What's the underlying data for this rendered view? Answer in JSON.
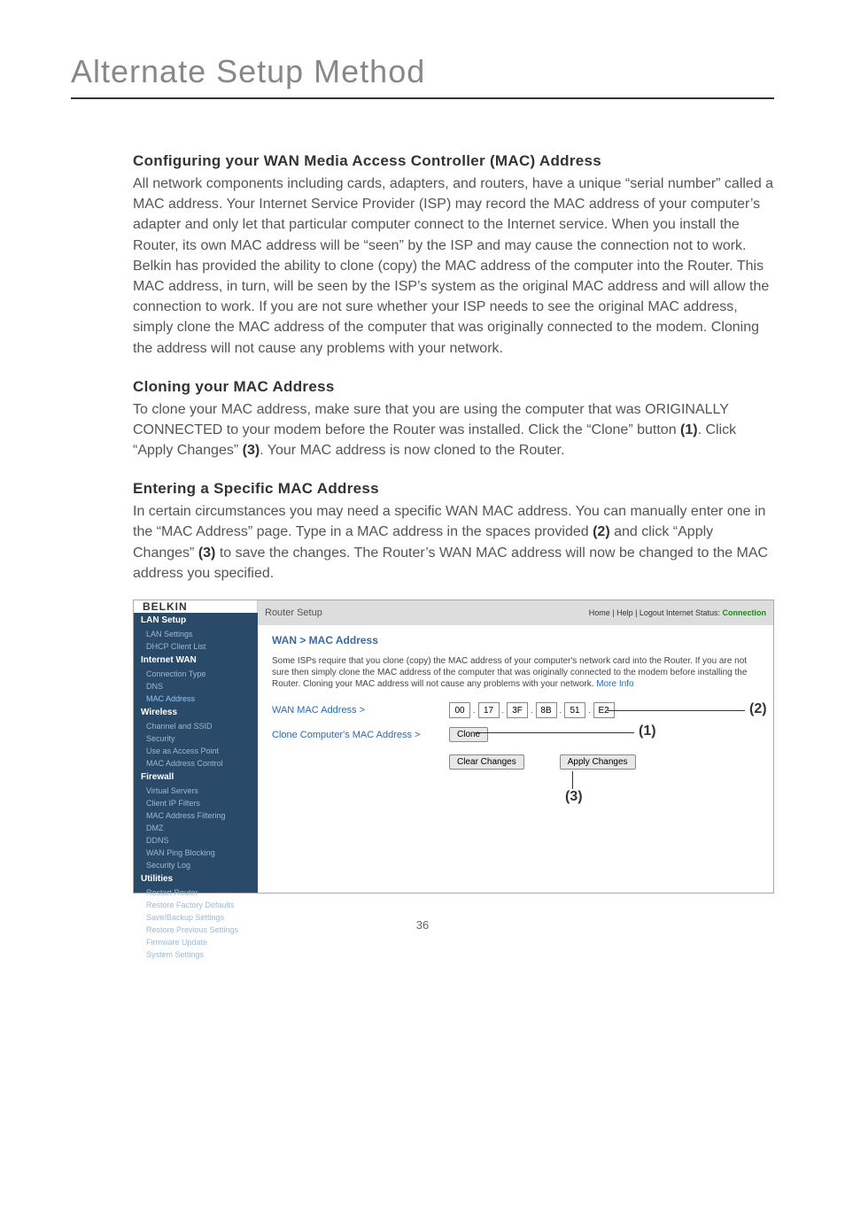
{
  "page_title": "Alternate Setup Method",
  "page_number": "36",
  "sections": {
    "configuring": {
      "heading": "Configuring your WAN Media Access Controller (MAC) Address",
      "body": "All network components including cards, adapters, and routers, have a unique “serial number” called a MAC address. Your Internet Service Provider (ISP) may record the MAC address of your computer’s adapter and only let that particular computer connect to the Internet service. When you install the Router, its own MAC address will be “seen” by the ISP and may cause the connection not to work. Belkin has provided the ability to clone (copy) the MAC address of the computer into the Router. This MAC address, in turn, will be seen by the ISP’s system as the original MAC address and will allow the connection to work. If you are not sure whether your ISP needs to see the original MAC address, simply clone the MAC address of the computer that was originally connected to the modem. Cloning the address will not cause any problems with your network."
    },
    "cloning": {
      "heading": "Cloning your MAC Address",
      "body_pre": "To clone your MAC address, make sure that you are using the computer that was ORIGINALLY CONNECTED to your modem before the Router was installed. Click the “Clone” button ",
      "b1": "(1)",
      "body_mid": ". Click “Apply Changes” ",
      "b3": "(3)",
      "body_post": ". Your MAC address is now cloned to the Router."
    },
    "entering": {
      "heading": "Entering a Specific MAC Address",
      "body_pre": "In certain circumstances you may need a specific WAN MAC address. You can manually enter one in the “MAC Address” page. Type in a MAC address in the spaces provided ",
      "b2": "(2)",
      "body_mid": " and click “Apply Changes” ",
      "b3": "(3)",
      "body_post": " to save the changes. The Router’s WAN MAC address will now be changed to the MAC address you specified."
    }
  },
  "router": {
    "logo": "BELKIN",
    "topbar_title": "Router Setup",
    "status_links": "Home | Help | Logout   Internet Status:",
    "status_value": "Connection",
    "sidebar": {
      "g1": "LAN Setup",
      "i1": "LAN Settings",
      "i2": "DHCP Client List",
      "g2": "Internet WAN",
      "i3": "Connection Type",
      "i4": "DNS",
      "i5": "MAC Address",
      "g3": "Wireless",
      "i6": "Channel and SSID",
      "i7": "Security",
      "i8": "Use as Access Point",
      "i9": "MAC Address Control",
      "g4": "Firewall",
      "i10": "Virtual Servers",
      "i11": "Client IP Filters",
      "i12": "MAC Address Filtering",
      "i13": "DMZ",
      "i14": "DDNS",
      "i15": "WAN Ping Blocking",
      "i16": "Security Log",
      "g5": "Utilities",
      "i17": "Restart Router",
      "i18": "Restore Factory Defaults",
      "i19": "Save/Backup Settings",
      "i20": "Restore Previous Settings",
      "i21": "Firmware Update",
      "i22": "System Settings"
    },
    "content": {
      "breadcrumb": "WAN > MAC Address",
      "desc": "Some ISPs require that you clone (copy) the MAC address of your computer's network card into the Router. If you are not sure then simply clone the MAC address of the computer that was originally connected to the modem before installing the Router. Cloning your MAC address will not cause any problems with your network.",
      "more": "More Info",
      "label1": "WAN MAC Address >",
      "label2": "Clone Computer's MAC Address >",
      "mac": [
        "00",
        "17",
        "3F",
        "8B",
        "51",
        "E2"
      ],
      "clone_btn": "Clone",
      "clear_btn": "Clear Changes",
      "apply_btn": "Apply Changes"
    },
    "callouts": {
      "c1": "(1)",
      "c2": "(2)",
      "c3": "(3)"
    }
  }
}
